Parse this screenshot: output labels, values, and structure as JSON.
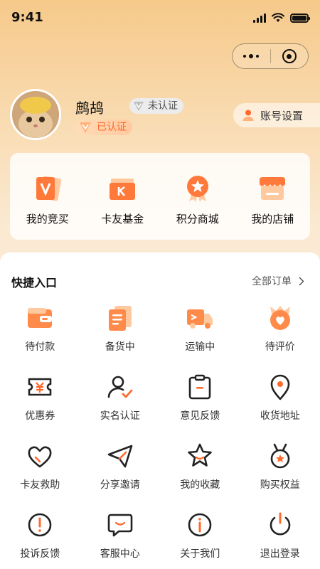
{
  "status_bar": {
    "time": "9:41"
  },
  "profile": {
    "name": "鹧鸪",
    "unverified_badge": "未认证",
    "verified_badge": "已认证",
    "account_settings": "账号设置"
  },
  "top_entries": [
    {
      "label": "我的竞买",
      "icon": "v-card-icon"
    },
    {
      "label": "卡友基金",
      "icon": "k-card-icon"
    },
    {
      "label": "积分商城",
      "icon": "medal-icon"
    },
    {
      "label": "我的店铺",
      "icon": "store-icon"
    }
  ],
  "quick_entry": {
    "title": "快捷入口",
    "all_orders": "全部订单",
    "items": [
      {
        "label": "待付款",
        "icon": "wallet-icon"
      },
      {
        "label": "备货中",
        "icon": "document-icon"
      },
      {
        "label": "运输中",
        "icon": "truck-icon"
      },
      {
        "label": "待评价",
        "icon": "heart-badge-icon"
      },
      {
        "label": "优惠券",
        "icon": "coupon-icon"
      },
      {
        "label": "实名认证",
        "icon": "user-check-icon"
      },
      {
        "label": "意见反馈",
        "icon": "clipboard-icon"
      },
      {
        "label": "收货地址",
        "icon": "location-icon"
      },
      {
        "label": "卡友救助",
        "icon": "heart-outline-icon"
      },
      {
        "label": "分享邀请",
        "icon": "send-icon"
      },
      {
        "label": "我的收藏",
        "icon": "star-icon"
      },
      {
        "label": "购买权益",
        "icon": "benefit-medal-icon"
      },
      {
        "label": "投诉反馈",
        "icon": "alert-icon"
      },
      {
        "label": "客服中心",
        "icon": "chat-icon"
      },
      {
        "label": "关于我们",
        "icon": "info-icon"
      },
      {
        "label": "退出登录",
        "icon": "power-icon"
      }
    ]
  },
  "colors": {
    "accent": "#ff6a2a",
    "accent_light": "#ffb27a"
  }
}
